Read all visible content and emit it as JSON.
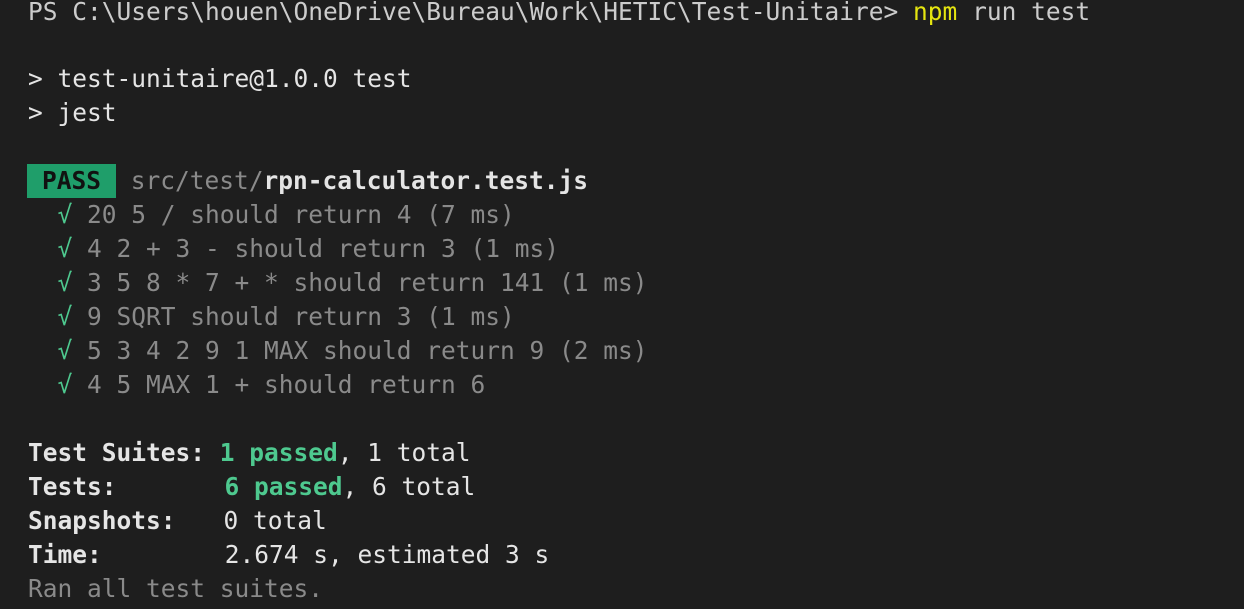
{
  "prompt": {
    "ps_prefix": "PS C:\\Users\\houen\\OneDrive\\Bureau\\Work\\HETIC\\Test-Unitaire>",
    "command_name": "npm",
    "command_args": "run test"
  },
  "script_header": {
    "line1": "> test-unitaire@1.0.0 test",
    "line2": "> jest"
  },
  "suite": {
    "status": "PASS",
    "path_dir": "src/test/",
    "path_file": "rpn-calculator.test.js"
  },
  "tests": [
    {
      "check": "√",
      "text": "20 5 / should return 4 (7 ms)"
    },
    {
      "check": "√",
      "text": "4 2 + 3 - should return 3 (1 ms)"
    },
    {
      "check": "√",
      "text": "3 5 8 * 7 + * should return 141 (1 ms)"
    },
    {
      "check": "√",
      "text": "9 SQRT should return 3 (1 ms)"
    },
    {
      "check": "√",
      "text": "5 3 4 2 9 1 MAX should return 9 (2 ms)"
    },
    {
      "check": "√",
      "text": "4 5 MAX 1 + should return 6"
    }
  ],
  "summary": {
    "suites_label": "Test Suites:",
    "suites_passed": "1 passed",
    "suites_total": ", 1 total",
    "tests_label": "Tests:",
    "tests_passed": "6 passed",
    "tests_total": ", 6 total",
    "snapshots_label": "Snapshots:",
    "snapshots_value": "0 total",
    "time_label": "Time:",
    "time_value": "2.674 s, estimated 3 s",
    "ran_all": "Ran all test suites."
  },
  "colors": {
    "background": "#1e1e1e",
    "foreground": "#cccccc",
    "yellow": "#e5e510",
    "green": "#4ec98f",
    "pass_badge": "#1f9e6a",
    "dim": "#8a8a8a"
  }
}
